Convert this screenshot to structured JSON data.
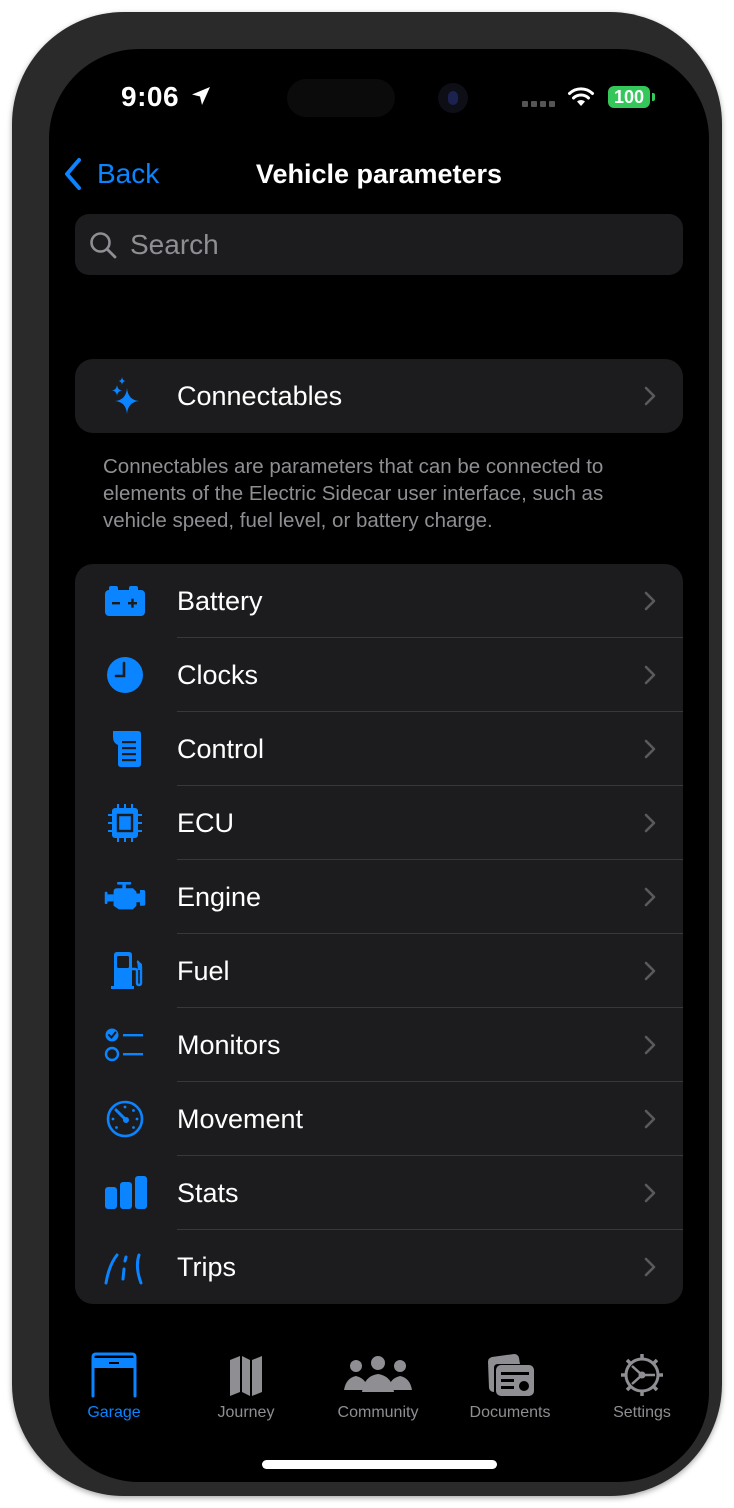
{
  "status_bar": {
    "time": "9:06",
    "battery": "100",
    "location_icon": "location-arrow-icon",
    "wifi_icon": "wifi-icon"
  },
  "nav": {
    "back_label": "Back",
    "title": "Vehicle parameters"
  },
  "search": {
    "placeholder": "Search",
    "value": ""
  },
  "connectables": {
    "label": "Connectables",
    "icon": "sparkles-icon",
    "footer": "Connectables are parameters that can be connected to elements of the Electric Sidecar user interface, such as vehicle speed, fuel level, or battery charge."
  },
  "categories": [
    {
      "label": "Battery",
      "icon": "battery-icon"
    },
    {
      "label": "Clocks",
      "icon": "clock-icon"
    },
    {
      "label": "Control",
      "icon": "scroll-icon"
    },
    {
      "label": "ECU",
      "icon": "cpu-icon"
    },
    {
      "label": "Engine",
      "icon": "engine-icon"
    },
    {
      "label": "Fuel",
      "icon": "fuel-pump-icon"
    },
    {
      "label": "Monitors",
      "icon": "checklist-icon"
    },
    {
      "label": "Movement",
      "icon": "speedometer-icon"
    },
    {
      "label": "Stats",
      "icon": "bar-chart-icon"
    },
    {
      "label": "Trips",
      "icon": "road-lanes-icon"
    }
  ],
  "tabs": [
    {
      "label": "Garage",
      "icon": "garage-icon",
      "active": true
    },
    {
      "label": "Journey",
      "icon": "map-icon",
      "active": false
    },
    {
      "label": "Community",
      "icon": "people-icon",
      "active": false
    },
    {
      "label": "Documents",
      "icon": "documents-icon",
      "active": false
    },
    {
      "label": "Settings",
      "icon": "gear-icon",
      "active": false
    }
  ],
  "colors": {
    "accent": "#0a84ff",
    "battery_green": "#34c759",
    "cell_background": "#1c1c1e",
    "secondary_text": "#8e8e93"
  }
}
